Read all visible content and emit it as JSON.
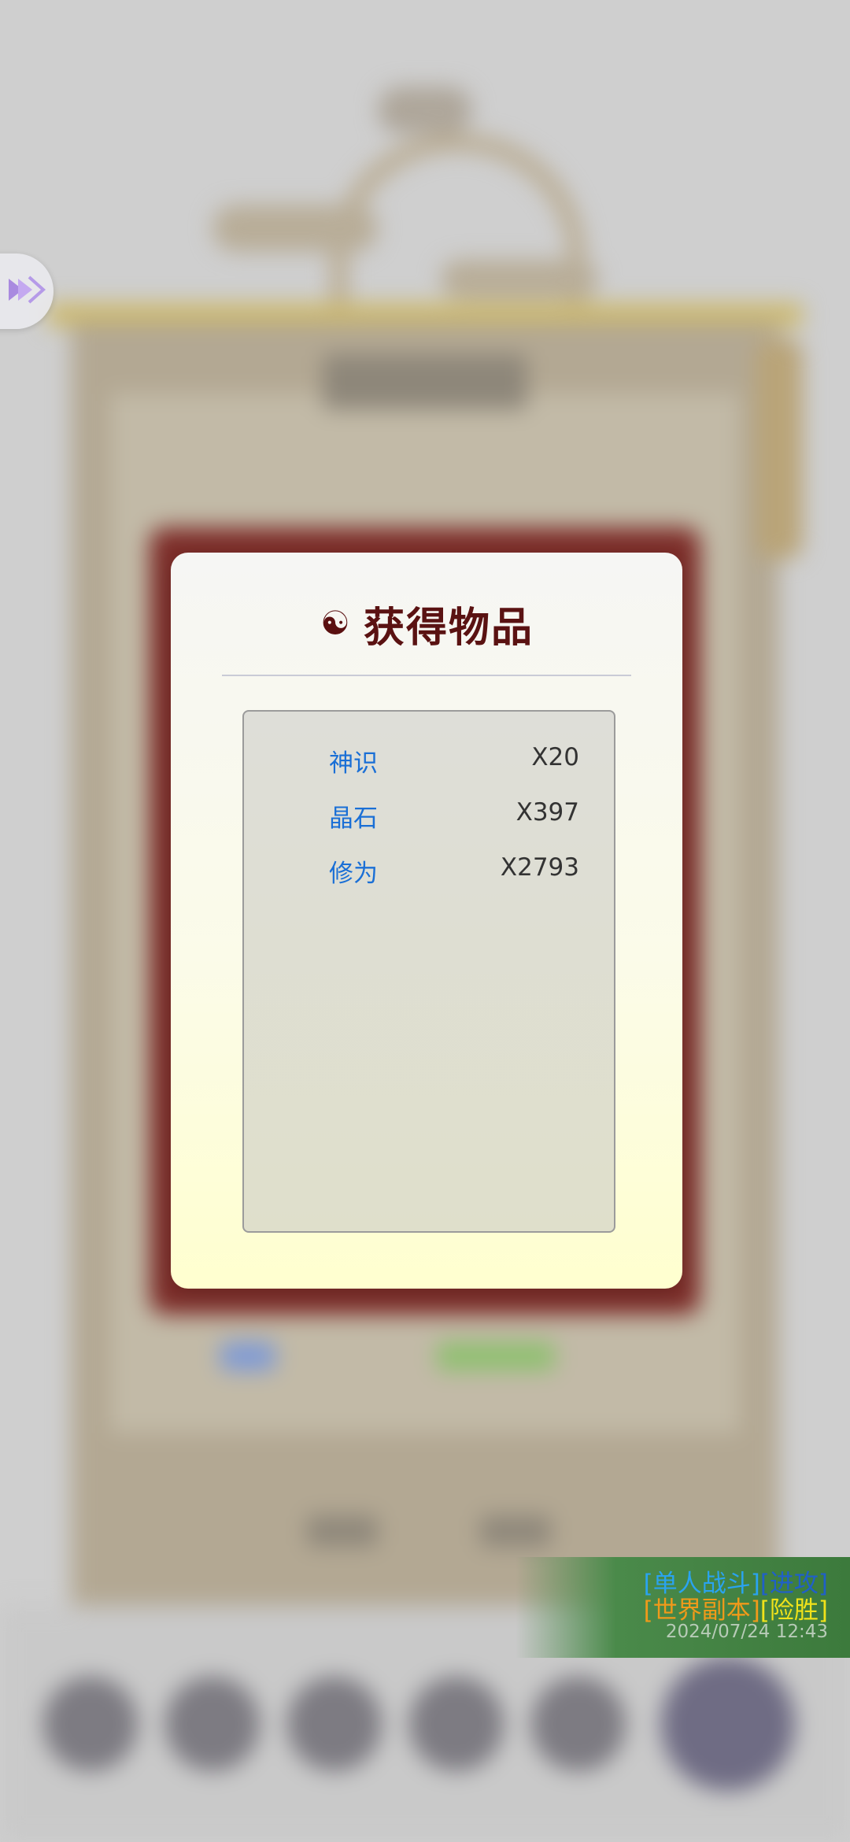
{
  "dialog": {
    "title": "获得物品",
    "icon": "yin-yang-icon",
    "items": [
      {
        "name": "神识",
        "quantity": "X20"
      },
      {
        "name": "晶石",
        "quantity": "X397"
      },
      {
        "name": "修为",
        "quantity": "X2793"
      }
    ]
  },
  "battle_log": {
    "line1": {
      "tag1": "[单人战斗]",
      "tag2": "[进攻]"
    },
    "line2": {
      "tag1": "[世界副本]",
      "tag2": "[险胜]"
    },
    "timestamp": "2024/07/24 12:43"
  },
  "side_button": {
    "icon": "double-chevron-icon"
  },
  "colors": {
    "title": "#5a1212",
    "item_name": "#1a6fd6",
    "log_blue": "#2aa3f0",
    "log_orange": "#f09a1a",
    "log_yellow": "#f0e21a"
  }
}
